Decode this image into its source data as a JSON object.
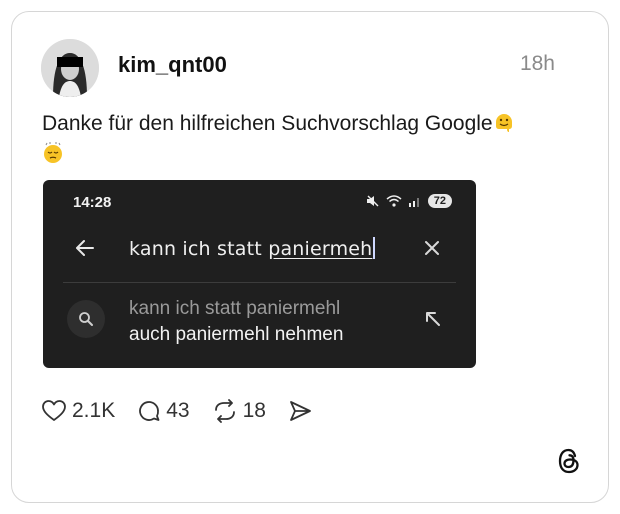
{
  "post": {
    "username": "kim_qnt00",
    "time": "18h",
    "text": "Danke für den hilfreichen Suchvorschlag Google",
    "emoji_1": "melting-face",
    "emoji_2": "pensive-face"
  },
  "screenshot": {
    "status_time": "14:28",
    "battery": "72",
    "search_query_prefix": "kann ich statt ",
    "search_query_underlined": "paniermeh",
    "suggestion_line1": "kann ich statt paniermehl",
    "suggestion_line2": "auch paniermehl nehmen"
  },
  "actions": {
    "likes": "2.1K",
    "replies": "43",
    "reposts": "18"
  },
  "colors": {
    "screenshot_bg": "#1f1f1f",
    "card_border": "#d6d6d6",
    "muted": "#8a8a8a"
  }
}
